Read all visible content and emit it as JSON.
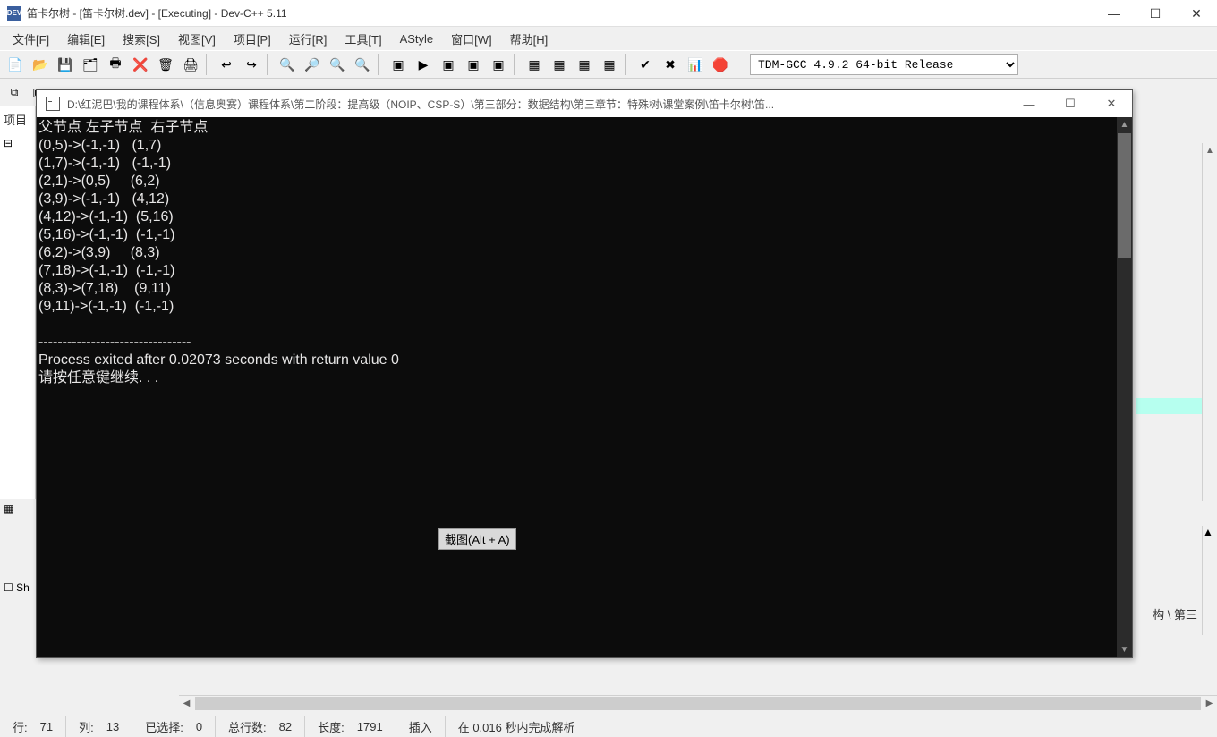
{
  "main_window": {
    "title": "笛卡尔树 - [笛卡尔树.dev] - [Executing] - Dev-C++ 5.11",
    "app_icon_text": "DEV"
  },
  "menubar": {
    "items": [
      "文件[F]",
      "编辑[E]",
      "搜索[S]",
      "视图[V]",
      "项目[P]",
      "运行[R]",
      "工具[T]",
      "AStyle",
      "窗口[W]",
      "帮助[H]"
    ]
  },
  "toolbar": {
    "groups": [
      [
        "📄",
        "📂",
        "💾",
        "🗂",
        "🖶",
        "❌",
        "🗑",
        "🖨"
      ],
      [
        "↩",
        "↪"
      ],
      [
        "🔍",
        "🔎",
        "🔍",
        "🔍"
      ],
      [
        "▣",
        "▶",
        "▣",
        "▣",
        "▣"
      ],
      [
        "▦",
        "▦",
        "▦",
        "▦"
      ],
      [
        "✔",
        "✖",
        "📊",
        "🛑"
      ]
    ],
    "compiler": "TDM-GCC 4.9.2 64-bit Release"
  },
  "sidebar": {
    "label": "项目",
    "tree_expand": "⊟"
  },
  "lower_panel": {
    "checkbox_label": "Sh"
  },
  "right_text": "构 \\ 第三",
  "console": {
    "title": "D:\\红泥巴\\我的课程体系\\（信息奥赛）课程体系\\第二阶段：提高级（NOIP、CSP-S）\\第三部分：数据结构\\第三章节：特殊树\\课堂案例\\笛卡尔树\\笛...",
    "header": "父节点 左子节点  右子节点",
    "rows": [
      "(0,5)->(-1,-1)   (1,7)",
      "(1,7)->(-1,-1)   (-1,-1)",
      "(2,1)->(0,5)     (6,2)",
      "(3,9)->(-1,-1)   (4,12)",
      "(4,12)->(-1,-1)  (5,16)",
      "(5,16)->(-1,-1)  (-1,-1)",
      "(6,2)->(3,9)     (8,3)",
      "(7,18)->(-1,-1)  (-1,-1)",
      "(8,3)->(7,18)    (9,11)",
      "(9,11)->(-1,-1)  (-1,-1)"
    ],
    "dashes": "--------------------------------",
    "exit_msg": "Process exited after 0.02073 seconds with return value 0",
    "press_key": "请按任意键继续. . ."
  },
  "tooltip": "截图(Alt + A)",
  "statusbar": {
    "row_label": "行:",
    "row_value": "71",
    "col_label": "列:",
    "col_value": "13",
    "sel_label": "已选择:",
    "sel_value": "0",
    "total_label": "总行数:",
    "total_value": "82",
    "len_label": "长度:",
    "len_value": "1791",
    "mode": "插入",
    "parse_msg": "在 0.016 秒内完成解析"
  },
  "win_controls": {
    "min": "—",
    "max": "☐",
    "close": "✕"
  }
}
